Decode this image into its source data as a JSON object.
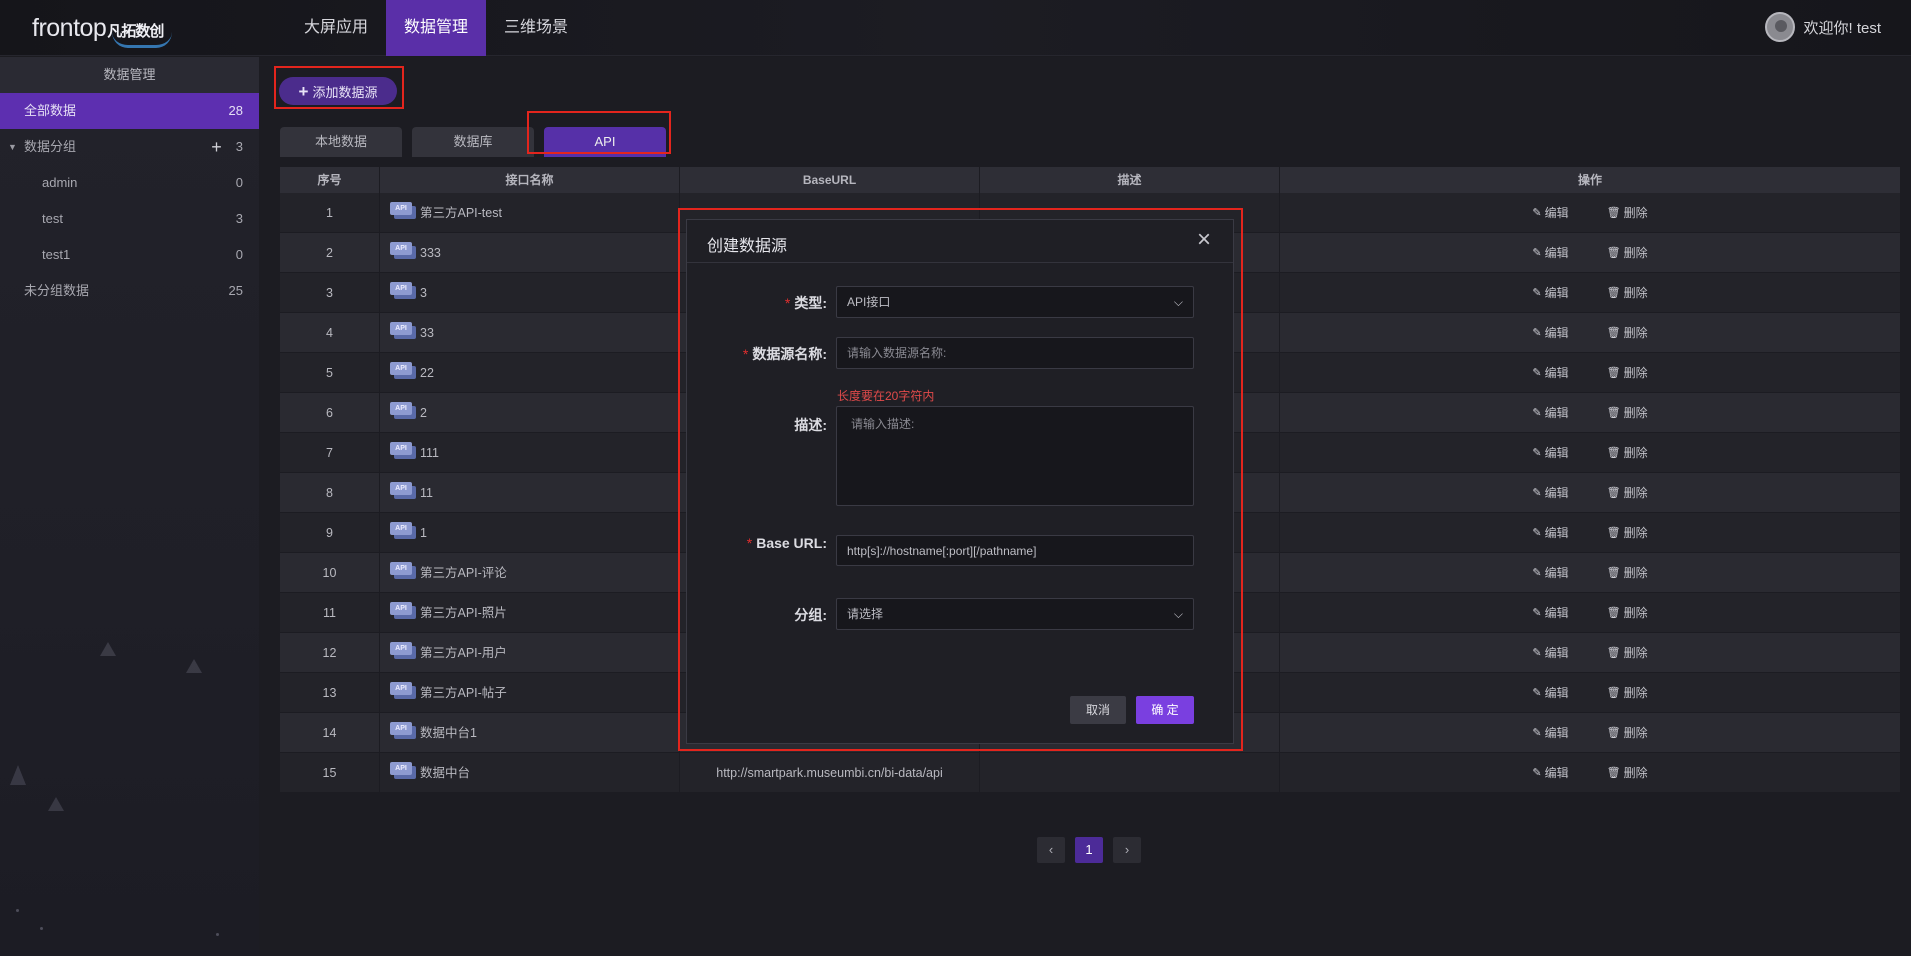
{
  "header": {
    "logo_en": "frontop",
    "logo_cn": "凡拓数创",
    "nav": [
      "大屏应用",
      "数据管理",
      "三维场景"
    ],
    "active_nav": 1,
    "welcome": "欢迎你! test"
  },
  "sidebar": {
    "title": "数据管理",
    "all": {
      "label": "全部数据",
      "count": "28"
    },
    "group": {
      "label": "数据分组",
      "count": "3"
    },
    "children": [
      {
        "label": "admin",
        "count": "0"
      },
      {
        "label": "test",
        "count": "3"
      },
      {
        "label": "test1",
        "count": "0"
      }
    ],
    "ungrouped": {
      "label": "未分组数据",
      "count": "25"
    }
  },
  "toolbar": {
    "add_label": "添加数据源"
  },
  "tabs": [
    "本地数据",
    "数据库",
    "API"
  ],
  "active_tab": 2,
  "table": {
    "headers": {
      "no": "序号",
      "name": "接口名称",
      "url": "BaseURL",
      "desc": "描述",
      "op": "操作"
    },
    "api_badge": "API",
    "rows": [
      {
        "no": "1",
        "name": "第三方API-test",
        "url": "",
        "desc": ""
      },
      {
        "no": "2",
        "name": "333",
        "url": "",
        "desc": ""
      },
      {
        "no": "3",
        "name": "3",
        "url": "",
        "desc": ""
      },
      {
        "no": "4",
        "name": "33",
        "url": "",
        "desc": ""
      },
      {
        "no": "5",
        "name": "22",
        "url": "",
        "desc": ""
      },
      {
        "no": "6",
        "name": "2",
        "url": "",
        "desc": ""
      },
      {
        "no": "7",
        "name": "111",
        "url": "",
        "desc": ""
      },
      {
        "no": "8",
        "name": "11",
        "url": "",
        "desc": ""
      },
      {
        "no": "9",
        "name": "1",
        "url": "",
        "desc": ""
      },
      {
        "no": "10",
        "name": "第三方API-评论",
        "url": "",
        "desc": ""
      },
      {
        "no": "11",
        "name": "第三方API-照片",
        "url": "",
        "desc": ""
      },
      {
        "no": "12",
        "name": "第三方API-用户",
        "url": "",
        "desc": ""
      },
      {
        "no": "13",
        "name": "第三方API-帖子",
        "url": "",
        "desc": ""
      },
      {
        "no": "14",
        "name": "数据中台1",
        "url": "",
        "desc": ""
      },
      {
        "no": "15",
        "name": "数据中台",
        "url": "http://smartpark.museumbi.cn/bi-data/api",
        "desc": ""
      }
    ],
    "edit_label": "编辑",
    "delete_label": "删除"
  },
  "pager": {
    "prev": "‹",
    "current": "1",
    "next": "›"
  },
  "modal": {
    "title": "创建数据源",
    "close": "×",
    "type_label": "类型:",
    "type_value": "API接口",
    "name_label": "数据源名称:",
    "name_placeholder": "请输入数据源名称:",
    "name_error": "长度要在20字符内",
    "desc_label": "描述:",
    "desc_placeholder": "请输入描述:",
    "url_label": "Base URL:",
    "url_value": "http[s]://hostname[:port][/pathname]",
    "group_label": "分组:",
    "group_placeholder": "请选择",
    "cancel": "取消",
    "ok": "确 定"
  },
  "colors": {
    "accent": "#5a2fa8",
    "highlight": "#e3251d",
    "ok_button": "#7a3fe0"
  }
}
